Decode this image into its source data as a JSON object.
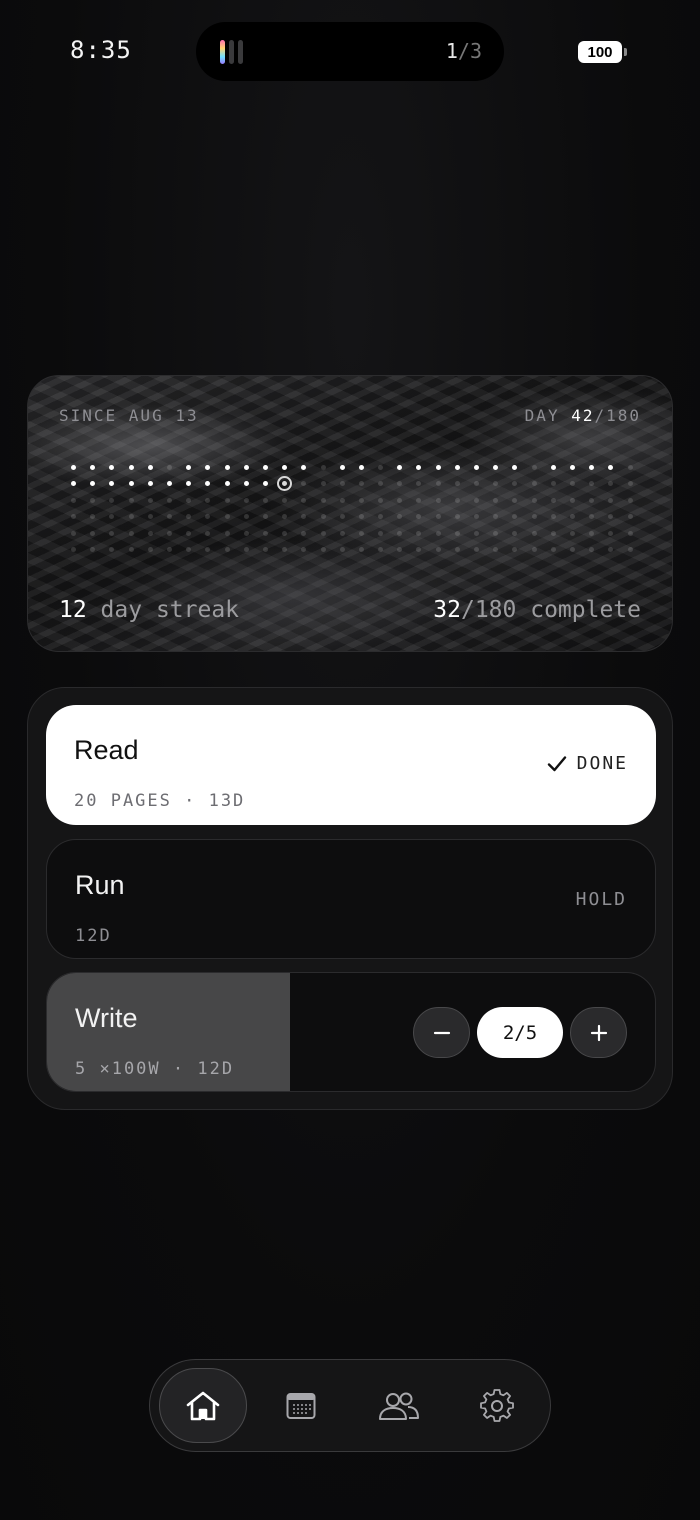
{
  "status_bar": {
    "time": "8:35",
    "island": {
      "page_current": "1",
      "page_separator": "/",
      "page_total": "3"
    },
    "battery": "100"
  },
  "hero": {
    "since_label": "SINCE AUG 13",
    "day_prefix": "DAY ",
    "day_current": "42",
    "day_total": "/180",
    "streak_value": "12",
    "streak_label": " day streak",
    "complete_value": "32",
    "complete_label": "/180 complete",
    "total_days": 180,
    "today_index": 41,
    "done_days": [
      0,
      1,
      2,
      3,
      4,
      6,
      7,
      8,
      9,
      10,
      11,
      12,
      14,
      15,
      17,
      18,
      19,
      20,
      21,
      22,
      23,
      25,
      26,
      27,
      28,
      30,
      31,
      32,
      33,
      34,
      35,
      36,
      37,
      38,
      39,
      40,
      41
    ]
  },
  "habits": {
    "read": {
      "name": "Read",
      "meta": "20 PAGES · 13D",
      "status": "DONE",
      "status_icon": "check-icon"
    },
    "run": {
      "name": "Run",
      "meta": "12D",
      "status": "HOLD"
    },
    "write": {
      "name": "Write",
      "meta": "5 ×100W · 12D",
      "progress_value": "2/5",
      "progress": 0.4,
      "decrement_icon": "minus-icon",
      "increment_icon": "plus-icon"
    }
  },
  "tabbar": {
    "tabs": [
      {
        "id": "home",
        "icon": "home-icon",
        "active": true
      },
      {
        "id": "calendar",
        "icon": "calendar-icon",
        "active": false
      },
      {
        "id": "friends",
        "icon": "people-icon",
        "active": false
      },
      {
        "id": "settings",
        "icon": "gear-icon",
        "active": false
      }
    ]
  }
}
